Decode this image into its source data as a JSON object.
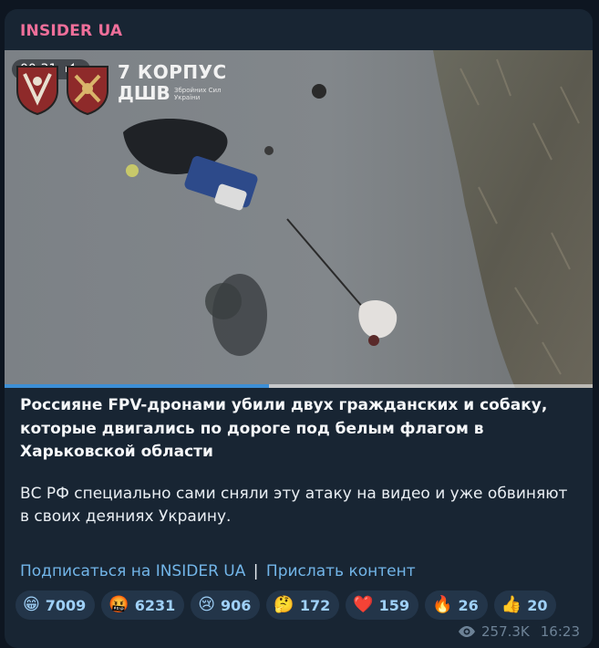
{
  "channel": {
    "name": "INSIDER UA"
  },
  "video": {
    "time": "00:31",
    "progress": 0.45,
    "overlay": {
      "corps_title": "7 КОРПУС",
      "corps_sub": "ДШВ",
      "corps_tiny": "Збройних Сил України"
    }
  },
  "post": {
    "headline": "Россияне FPV-дронами убили двух гражданских и собаку, которые двигались по дороге под белым флагом в Харьковской области",
    "body": "ВС РФ специально сами сняли эту атаку на видео и уже обвиняют в своих деяниях Украину."
  },
  "links": {
    "subscribe": "Подписаться на INSIDER UA",
    "separator": "|",
    "submit": "Прислать контент"
  },
  "reactions": [
    {
      "icon": "grinning-face-icon",
      "emoji": "😁",
      "count": "7009"
    },
    {
      "icon": "cursing-face-icon",
      "emoji": "🤬",
      "count": "6231"
    },
    {
      "icon": "crying-face-icon",
      "emoji": "😢",
      "count": "906"
    },
    {
      "icon": "thinking-face-icon",
      "emoji": "🤔",
      "count": "172"
    },
    {
      "icon": "red-heart-icon",
      "emoji": "❤️",
      "count": "159"
    },
    {
      "icon": "fire-icon",
      "emoji": "🔥",
      "count": "26"
    },
    {
      "icon": "thumbs-up-icon",
      "emoji": "👍",
      "count": "20"
    }
  ],
  "meta": {
    "views": "257.3K",
    "time": "16:23"
  },
  "colors": {
    "background": "#0e1621",
    "bubble": "#182533",
    "channel_name": "#ef6f9a",
    "link": "#72b5e8",
    "reaction_bg": "#233549",
    "progress": "#3d8fd6"
  }
}
